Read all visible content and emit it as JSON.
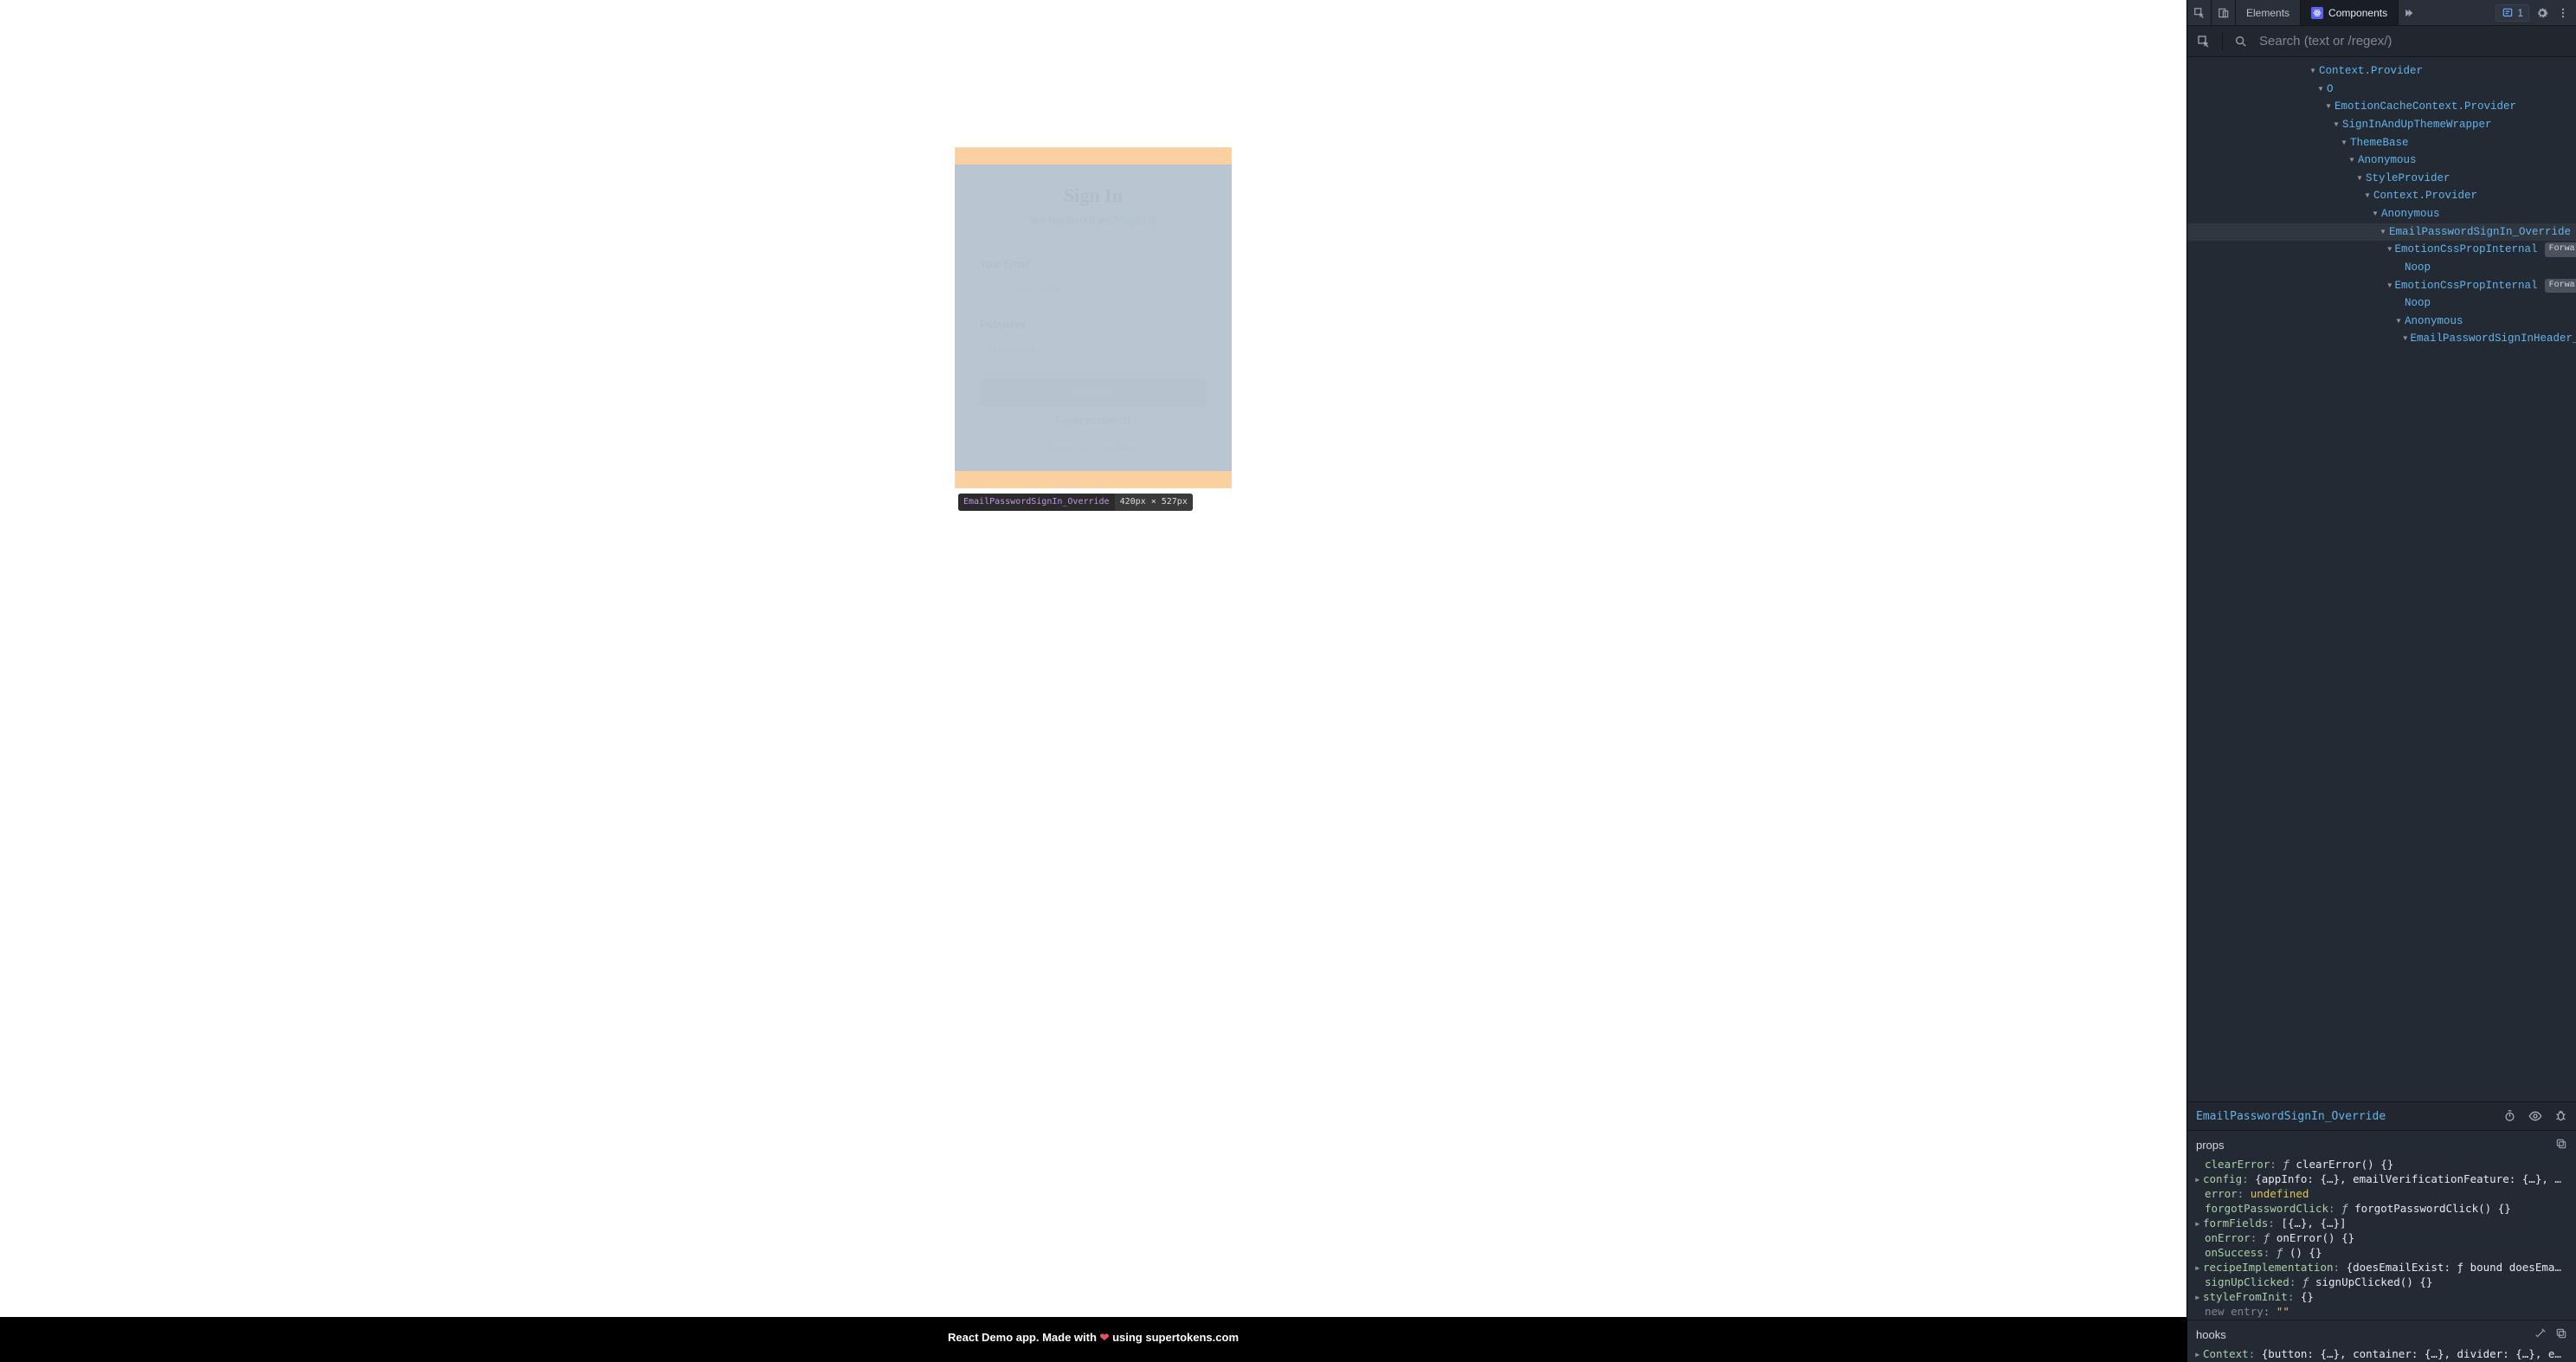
{
  "app": {
    "login": {
      "title": "Sign In",
      "subtext": "Not registered yet?",
      "signup_link": "Sign Up",
      "email_label": "Your Email",
      "email_placeholder": "Your work email",
      "password_label": "Password",
      "password_placeholder": "Password",
      "button": "SIGN IN",
      "forgot": "Forgot password?",
      "powered": "Powered by SuperTokens"
    },
    "inspect_tooltip": {
      "name": "EmailPasswordSignIn_Override",
      "dims": "420px × 527px"
    },
    "footer_a": "React Demo app. Made with",
    "footer_b": "using supertokens.com"
  },
  "devtools": {
    "tabs": {
      "elements": "Elements",
      "components": "Components"
    },
    "issues_count": "1",
    "search_placeholder": "Search (text or /regex/)",
    "tree": [
      {
        "depth": 0,
        "name": "Context.Provider",
        "caret": "▾"
      },
      {
        "depth": 1,
        "name": "O",
        "caret": "▾"
      },
      {
        "depth": 2,
        "name": "EmotionCacheContext.Provider",
        "caret": "▾"
      },
      {
        "depth": 3,
        "name": "SignInAndUpThemeWrapper",
        "caret": "▾"
      },
      {
        "depth": 4,
        "name": "ThemeBase",
        "caret": "▾"
      },
      {
        "depth": 5,
        "name": "Anonymous",
        "caret": "▾"
      },
      {
        "depth": 6,
        "name": "StyleProvider",
        "caret": "▾"
      },
      {
        "depth": 7,
        "name": "Context.Provider",
        "caret": "▾"
      },
      {
        "depth": 8,
        "name": "Anonymous",
        "caret": "▾"
      },
      {
        "depth": 9,
        "name": "EmailPasswordSignIn_Override",
        "caret": "▾",
        "selected": true
      },
      {
        "depth": 10,
        "name": "EmotionCssPropInternal",
        "caret": "▾",
        "badge": "ForwardRef"
      },
      {
        "depth": 11,
        "name": "Noop",
        "caret": ""
      },
      {
        "depth": 10,
        "name": "EmotionCssPropInternal",
        "caret": "▾",
        "badge": "ForwardRef"
      },
      {
        "depth": 11,
        "name": "Noop",
        "caret": ""
      },
      {
        "depth": 11,
        "name": "Anonymous",
        "caret": "▾"
      },
      {
        "depth": 12,
        "name": "EmailPasswordSignInHeader_Overri",
        "caret": "▾"
      }
    ],
    "selected_name": "EmailPasswordSignIn_Override",
    "props_label": "props",
    "hooks_label": "hooks",
    "props": [
      {
        "key": "clearError",
        "value": "ƒ clearError() {}",
        "type": "func"
      },
      {
        "key": "config",
        "value": "{appInfo: {…}, emailVerificationFeature: {…}, getRe…}",
        "type": "obj",
        "caret": true
      },
      {
        "key": "error",
        "value": "undefined",
        "type": "undef"
      },
      {
        "key": "forgotPasswordClick",
        "value": "ƒ forgotPasswordClick() {}",
        "type": "func"
      },
      {
        "key": "formFields",
        "value": "[{…}, {…}]",
        "type": "obj",
        "caret": true
      },
      {
        "key": "onError",
        "value": "ƒ onError() {}",
        "type": "func"
      },
      {
        "key": "onSuccess",
        "value": "ƒ () {}",
        "type": "func"
      },
      {
        "key": "recipeImplementation",
        "value": "{doesEmailExist: ƒ bound doesEmailExist(",
        "type": "obj",
        "caret": true
      },
      {
        "key": "signUpClicked",
        "value": "ƒ signUpClicked() {}",
        "type": "func"
      },
      {
        "key": "styleFromInit",
        "value": "{}",
        "type": "obj",
        "caret": true
      },
      {
        "key": "new entry",
        "value": "\"\"",
        "type": "newentry"
      }
    ],
    "hooks": [
      {
        "key": "Context",
        "value": "{button: {…}, container: {…}, divider: {…}, emailVe…}",
        "type": "obj",
        "caret": true
      }
    ]
  }
}
